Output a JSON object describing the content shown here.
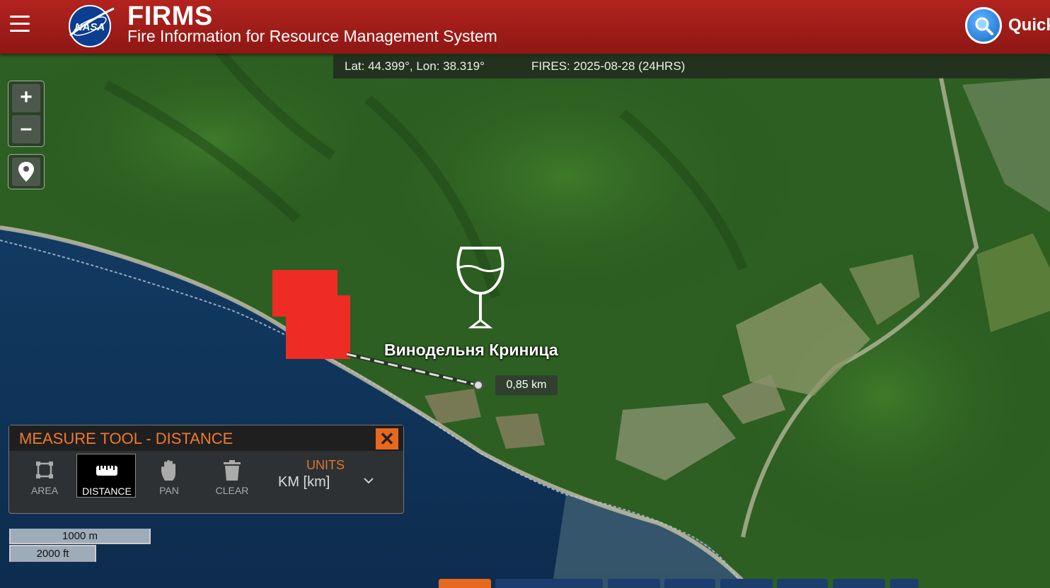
{
  "header": {
    "logo_text": "NASA",
    "title": "FIRMS",
    "subtitle": "Fire Information for Resource Management System",
    "search_label": "Quick",
    "icons": [
      "menu-icon",
      "search-icon"
    ]
  },
  "coordbar": {
    "latlon": "Lat: 44.399°, Lon: 38.319°",
    "fires": "FIRES: 2025-08-28 (24HRS)"
  },
  "map_controls": {
    "zoom_in": "+",
    "zoom_out": "–",
    "locate_icon": "map-pin-icon"
  },
  "map": {
    "place_label": "Винодельня Криница",
    "place_icon": "wine-glass-icon",
    "distance_label": "0,85 km",
    "fire_color": "#ee2b24"
  },
  "measure_tool": {
    "title": "MEASURE TOOL - DISTANCE",
    "close": "✕",
    "tools": [
      {
        "label": "AREA",
        "icon": "area-icon",
        "active": false
      },
      {
        "label": "DISTANCE",
        "icon": "ruler-icon",
        "active": true
      },
      {
        "label": "PAN",
        "icon": "hand-icon",
        "active": false
      },
      {
        "label": "CLEAR",
        "icon": "trash-icon",
        "active": false
      }
    ],
    "units_label": "UNITS",
    "units_value": "KM [km]"
  },
  "scale": {
    "metric": "1000 m",
    "imperial": "2000 ft"
  },
  "colors": {
    "header": "#a81f1a",
    "accent": "#e8681e"
  }
}
